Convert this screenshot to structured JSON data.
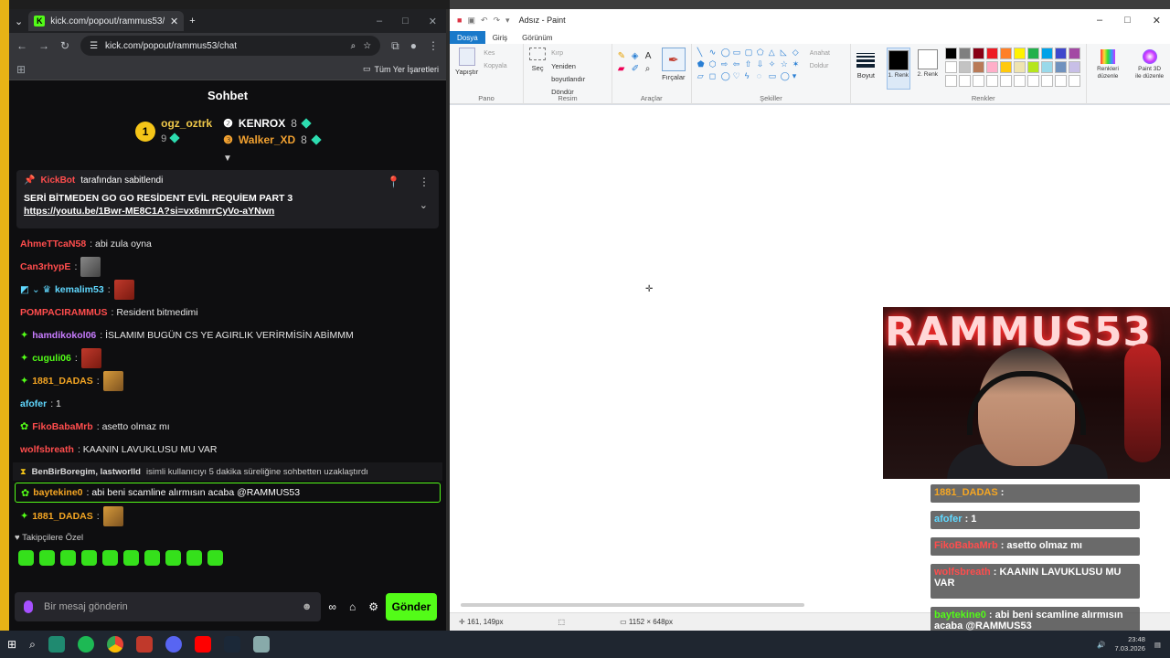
{
  "browser": {
    "tab_title": "kick.com/popout/rammus53/c",
    "url": "kick.com/popout/rammus53/chat",
    "bookmarks_label": "Tüm Yer İşaretleri"
  },
  "chat": {
    "title": "Sohbet",
    "leaderboard": {
      "first": {
        "rank": "1",
        "name": "ogz_oztrk",
        "count": "9"
      },
      "second": {
        "name": "KENROX",
        "count": "8"
      },
      "third": {
        "name": "Walker_XD",
        "count": "8"
      }
    },
    "pinned": {
      "by_user": "KickBot",
      "by_suffix": "tarafından sabitlendi",
      "text": "SERİ BİTMEDEN GO GO RESİDENT EVİL REQUİEM PART 3",
      "link": "https://youtu.be/1Bwr-ME8C1A?si=vx6mrrCyVo-aYNwn"
    },
    "messages": [
      {
        "user": "AhmeTTcaN58",
        "color": "#ff4d4d",
        "text": ": abi zula oyna",
        "emote": ""
      },
      {
        "user": "Can3rhypE",
        "color": "#ff4d4d",
        "text": ":",
        "emote": "gray"
      },
      {
        "user": "kemalim53",
        "color": "#60d8ff",
        "text": ":",
        "emote": "red"
      },
      {
        "user": "POMPACIRAMMUS",
        "color": "#ff4d4d",
        "text": ": Resident bitmedimi",
        "emote": ""
      },
      {
        "user": "hamdikokol06",
        "color": "#c87cff",
        "text": ": İSLAMIM BUGÜN CS YE AGIRLIK VERİRMİSİN ABİMMM",
        "emote": ""
      },
      {
        "user": "cuguli06",
        "color": "#53fc18",
        "text": ":",
        "emote": "red"
      },
      {
        "user": "1881_DADAS",
        "color": "#f5a623",
        "text": ":",
        "emote": "brown"
      },
      {
        "user": "afofer",
        "color": "#60d8ff",
        "text": ": 1",
        "emote": ""
      },
      {
        "user": "FikoBabaMrb",
        "color": "#ff4d4d",
        "text": ": asetto olmaz mı",
        "emote": ""
      },
      {
        "user": "wolfsbreath",
        "color": "#ff4d4d",
        "text": ": KAANIN LAVUKLUSU MU VAR",
        "emote": ""
      }
    ],
    "system_message": {
      "users": "BenBirBoregim, lastworlld",
      "text": "isimli kullanıcıyı 5 dakika süreliğine sohbetten uzaklaştırdı"
    },
    "highlight": {
      "user": "baytekine0",
      "text": ": abi beni scamline alırmısın acaba @RAMMUS53"
    },
    "last_message": {
      "user": "1881_DADAS",
      "text": ":"
    },
    "followers_label": "Takipçilere Özel",
    "input_placeholder": "Bir mesaj gönderin",
    "send_label": "Gönder"
  },
  "paint": {
    "title": "Adsız - Paint",
    "tabs": [
      "Dosya",
      "Giriş",
      "Görünüm"
    ],
    "groups": {
      "pano": "Pano",
      "resim": "Resim",
      "araclar": "Araçlar",
      "sekiller": "Şekiller",
      "renkler": "Renkler"
    },
    "labels": {
      "paste": "Yapıştır",
      "cut": "Kes",
      "copy": "Kopyala",
      "select": "Seç",
      "crop": "Kırp",
      "resize": "Yeniden boyutlandır",
      "rotate": "Döndür",
      "brushes": "Fırçalar",
      "outline": "Anahat",
      "fill": "Doldur",
      "size": "Boyut",
      "color1": "1. Renk",
      "color2": "2. Renk",
      "edit_colors": "Renkleri düzenle",
      "paint3d": "Paint 3D ile düzenle"
    },
    "status": {
      "position": "161, 149px",
      "size": "1152 × 648px"
    },
    "palette": [
      "#000000",
      "#7f7f7f",
      "#880015",
      "#ed1c24",
      "#ff7f27",
      "#fff200",
      "#22b14c",
      "#00a2e8",
      "#3f48cc",
      "#a349a4",
      "#ffffff",
      "#c3c3c3",
      "#b97a57",
      "#ffaec9",
      "#ffc90e",
      "#efe4b0",
      "#b5e61d",
      "#99d9ea",
      "#7092be",
      "#c8bfe7"
    ]
  },
  "overlay": {
    "neon_text": "RAMMUS53",
    "chat": [
      {
        "user": "1881_DADAS",
        "color": "#f5a623",
        "text": ":"
      },
      {
        "user": "afofer",
        "color": "#60d8ff",
        "text": ": 1"
      },
      {
        "user": "FikoBabaMrb",
        "color": "#ff4d4d",
        "text": ": asetto olmaz mı"
      },
      {
        "user": "wolfsbreath",
        "color": "#ff4d4d",
        "text": ": KAANIN LAVUKLUSU MU VAR"
      },
      {
        "user": "baytekine0",
        "color": "#53fc18",
        "text": ": abi beni scamline alırmısın acaba @RAMMUS53"
      }
    ]
  },
  "taskbar": {
    "time": "23:48",
    "date": "7.03.2026"
  }
}
